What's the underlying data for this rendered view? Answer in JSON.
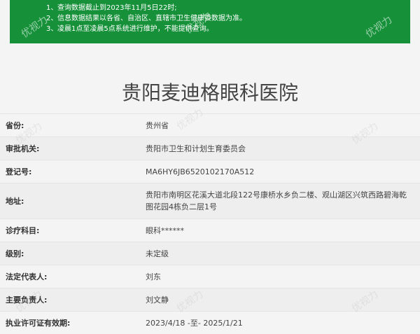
{
  "notice": {
    "items": [
      {
        "num": "1、",
        "text": "查询数据截止到2023年11月5日22时;"
      },
      {
        "num": "2、",
        "text": "信息数据结果以各省、自治区、直辖市卫生健康委数据为准。"
      },
      {
        "num": "3、",
        "text": "凌晨1点至凌晨5点系统进行维护，不能提供查询。"
      }
    ]
  },
  "watermark": "优视力",
  "title": "贵阳麦迪格眼科医院",
  "rows": [
    {
      "label": "省份:",
      "value": "贵州省"
    },
    {
      "label": "审批机关:",
      "value": "贵阳市卫生和计划生育委员会"
    },
    {
      "label": "登记号:",
      "value": "MA6HY6JB6520102170A512"
    },
    {
      "label": "地址:",
      "value": "贵阳市南明区花溪大道北段122号康桥水乡负二楼、观山湖区兴筑西路碧海乾图花园4栋负二层1号"
    },
    {
      "label": "诊疗科目:",
      "value": "眼科******"
    },
    {
      "label": "级别:",
      "value": "未定级"
    },
    {
      "label": "法定代表人:",
      "value": "刘东"
    },
    {
      "label": "主要负责人:",
      "value": "刘文静"
    },
    {
      "label": "执业许可证有效期:",
      "value": "2023/4/18 -至- 2025/1/21"
    }
  ]
}
